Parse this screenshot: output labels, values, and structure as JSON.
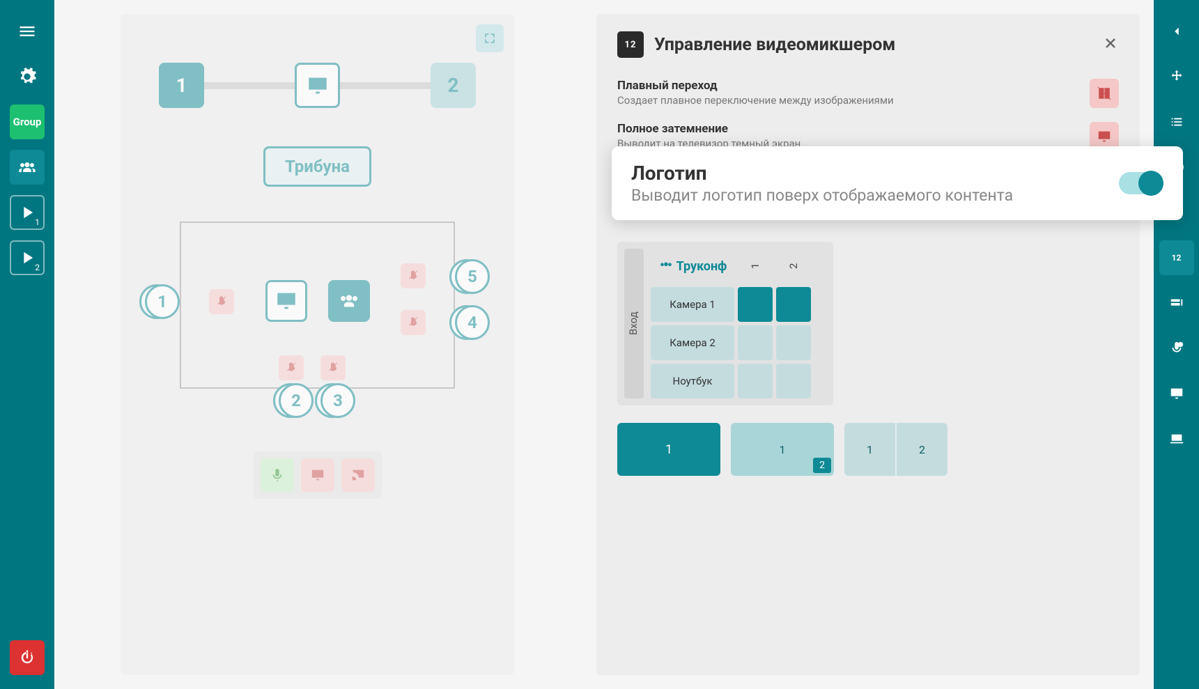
{
  "sidebar_left": {
    "group_label": "Group",
    "play1_sub": "1",
    "play2_sub": "2"
  },
  "left_card": {
    "node1": "1",
    "node2": "2",
    "tribune": "Трибуна",
    "seat1": "1",
    "seat2": "2",
    "seat3": "3",
    "seat4": "4",
    "seat5": "5"
  },
  "right_panel": {
    "icon_label": "12",
    "title": "Управление видеомикшером",
    "setting1_title": "Плавный переход",
    "setting1_desc": "Создает плавное переключение между изображениями",
    "setting2_title": "Полное затемнение",
    "setting2_desc": "Выводит на телевизор темный экран",
    "logo_title": "Логотип",
    "logo_desc": "Выводит логотип поверх отображаемого контента",
    "trukonf": "Труконф",
    "col1": "1",
    "col2": "2",
    "input_label": "Вход",
    "row1": "Камера 1",
    "row2": "Камера 2",
    "row3": "Ноутбук",
    "preset1": "1",
    "preset2a": "1",
    "preset2b": "2",
    "preset3a": "1",
    "preset3b": "2"
  }
}
